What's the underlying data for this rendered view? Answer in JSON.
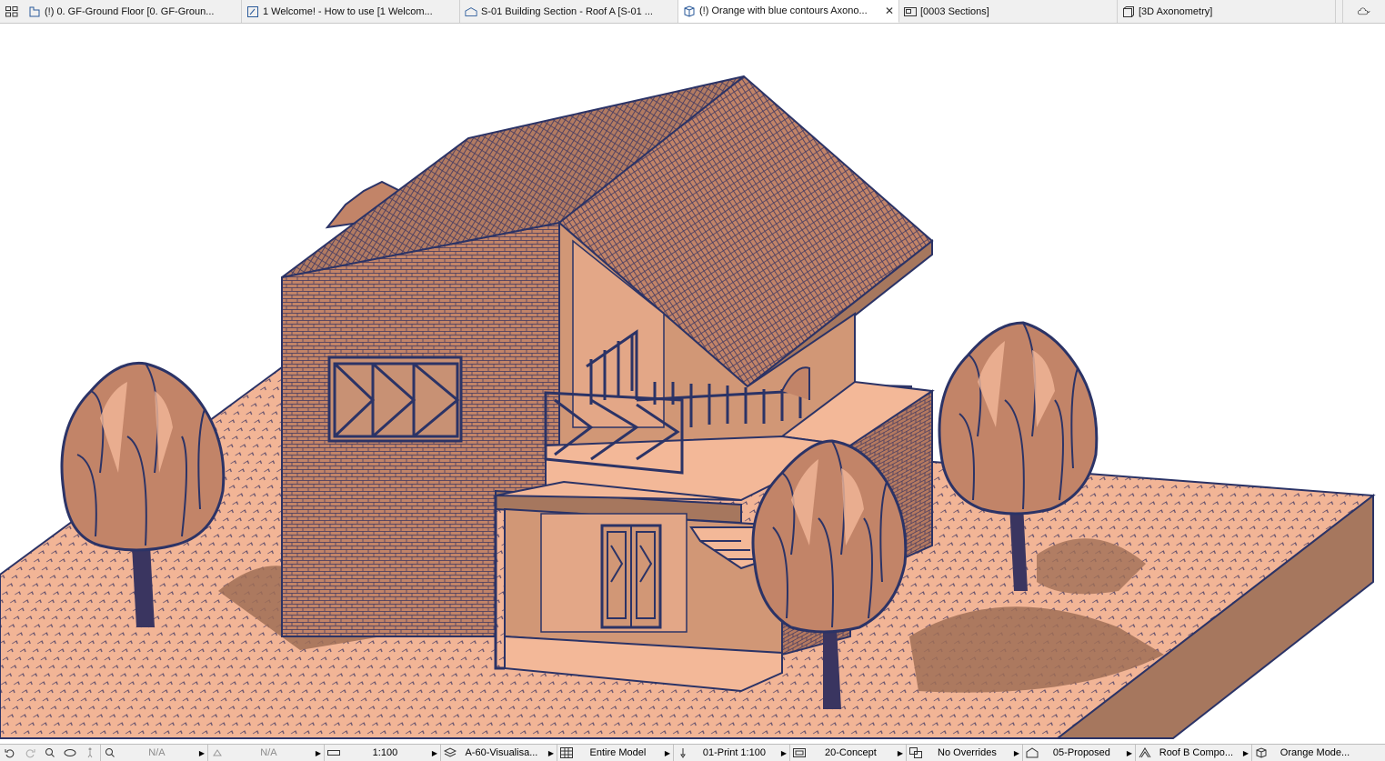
{
  "tabs": [
    {
      "label": "(!) 0. GF-Ground Floor [0. GF-Groun...",
      "icon": "floor-plan-icon",
      "active": false
    },
    {
      "label": "1 Welcome! - How to use [1 Welcom...",
      "icon": "worksheet-icon",
      "active": false
    },
    {
      "label": "S-01 Building Section - Roof A [S-01 ...",
      "icon": "section-icon",
      "active": false
    },
    {
      "label": "(!) Orange with blue contours Axono...",
      "icon": "3d-view-icon",
      "active": true,
      "close": "✕"
    },
    {
      "label": "[0003 Sections]",
      "icon": "layout-icon",
      "active": false
    },
    {
      "label": "[3D Axonometry]",
      "icon": "3d-window-icon",
      "active": false
    }
  ],
  "statusbar": {
    "nav_na_1": "N/A",
    "nav_na_2": "N/A",
    "scale": "1:100",
    "layer_combination": "A-60-Visualisa...",
    "model_view": "Entire Model",
    "pen_set": "01-Print 1:100",
    "mvo": "20-Concept",
    "graphic_override": "No Overrides",
    "renovation": "05-Proposed",
    "structure": "Roof B Compo...",
    "style": "Orange Mode..."
  },
  "colors": {
    "contour": "#2b3366",
    "fill": "#c4866a",
    "light": "#f3b898",
    "mid": "#d19776",
    "dark": "#a6775e",
    "shadow": "#a06f56"
  }
}
